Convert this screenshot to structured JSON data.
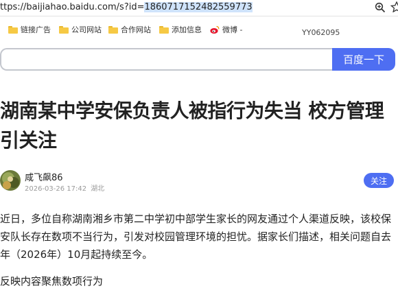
{
  "browser": {
    "url_prefix": "ttps://baijiahao.baidu.com/s?id=",
    "url_selected": "1860717152482559773"
  },
  "bookmarks": {
    "items": [
      {
        "label": "链接广告"
      },
      {
        "label": "公司网站"
      },
      {
        "label": "合作网站"
      },
      {
        "label": "添加信息"
      },
      {
        "label": "微博 -"
      }
    ],
    "watermark": "YY062095"
  },
  "search": {
    "value": "",
    "button_label": "百度一下"
  },
  "article": {
    "title": "湖南某中学安保负责人被指行为失当 校方管理引关注",
    "author": "咸飞飙86",
    "timestamp": "2026-03-26 17:42",
    "location": "湖北",
    "follow_label": "关注",
    "paragraph1": "近日，多位自称湖南湘乡市第二中学初中部学生家长的网友通过个人渠道反映，该校保安队长存在数项不当行为，引发对校园管理环境的担忧。据家长们描述，相关问题自去年（2026年）10月起持续至今。",
    "paragraph2": "反映内容聚焦数项行为"
  },
  "colors": {
    "accent": "#4e6ef2",
    "folder": "#f6c945",
    "meta_text": "#9a9a9a"
  },
  "icons": [
    "zoom-icon",
    "star-icon",
    "folder-icon",
    "weibo-icon",
    "avatar"
  ]
}
